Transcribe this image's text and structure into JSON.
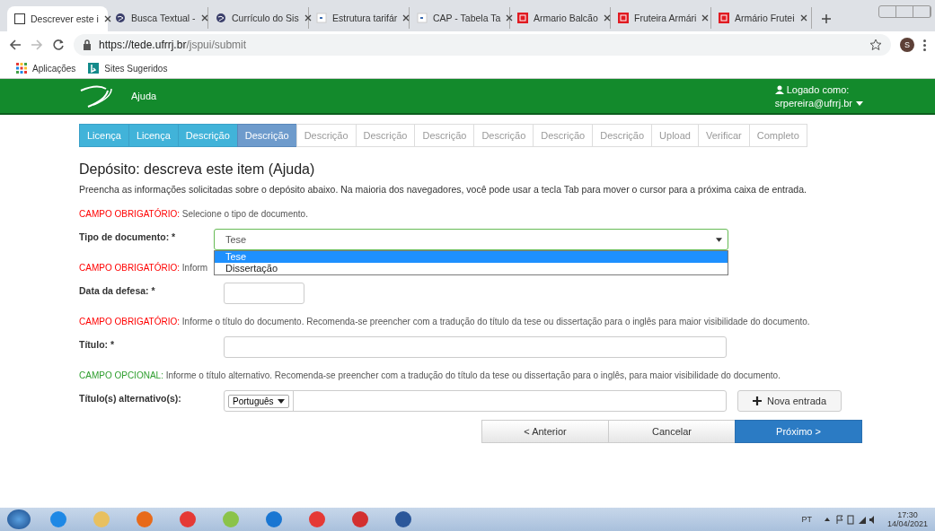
{
  "browser": {
    "tabs": [
      {
        "title": "Descrever este i",
        "kind": "d",
        "selected": true
      },
      {
        "title": "Busca Textual -",
        "kind": "globe",
        "selected": false
      },
      {
        "title": "Currículo do Sis",
        "kind": "globe",
        "selected": false
      },
      {
        "title": "Estrutura tarifár",
        "kind": "doc",
        "selected": false
      },
      {
        "title": "CAP - Tabela Ta",
        "kind": "doc",
        "selected": false
      },
      {
        "title": "Armario Balcão",
        "kind": "store",
        "selected": false
      },
      {
        "title": "Fruteira Armári",
        "kind": "store",
        "selected": false
      },
      {
        "title": "Armário Frutei",
        "kind": "store",
        "selected": false
      }
    ],
    "url_host": "https://tede.ufrrj.br",
    "url_path": "/jspui/submit",
    "profile_initial": "S",
    "bookmarks": [
      "Aplicações",
      "Sites Sugeridos"
    ]
  },
  "header": {
    "help": "Ajuda",
    "logged_label": "Logado como:",
    "user": "srpereira@ufrrj.br"
  },
  "steps": [
    {
      "label": "Licença",
      "kind": "done"
    },
    {
      "label": "Licença",
      "kind": "done"
    },
    {
      "label": "Descrição",
      "kind": "done"
    },
    {
      "label": "Descrição",
      "kind": "current"
    },
    {
      "label": "Descrição",
      "kind": "todo"
    },
    {
      "label": "Descrição",
      "kind": "todo"
    },
    {
      "label": "Descrição",
      "kind": "todo"
    },
    {
      "label": "Descrição",
      "kind": "todo"
    },
    {
      "label": "Descrição",
      "kind": "todo"
    },
    {
      "label": "Descrição",
      "kind": "todo"
    },
    {
      "label": "Upload",
      "kind": "todo"
    },
    {
      "label": "Verificar",
      "kind": "todo"
    },
    {
      "label": "Completo",
      "kind": "todo"
    }
  ],
  "title": "Depósito: descreva este item (Ajuda)",
  "intro": "Preencha as informações solicitadas sobre o depósito abaixo. Na maioria dos navegadores, você pode usar a tecla Tab para mover o cursor para a próxima caixa de entrada.",
  "fields": [
    {
      "kind": "select",
      "hint_tag": "CAMPO OBRIGATÓRIO:",
      "required": true,
      "hint": "Selecione o tipo de documento.",
      "label": "Tipo de documento: *",
      "value": "Tese",
      "options": [
        {
          "label": "Tese",
          "selected": true
        },
        {
          "label": "Dissertação",
          "selected": false
        }
      ]
    },
    {
      "kind": "date",
      "hint_tag": "CAMPO OBRIGATÓRIO:",
      "required": true,
      "hint": "Inform",
      "label": "Data da defesa: *"
    },
    {
      "kind": "text",
      "hint_tag": "CAMPO OBRIGATÓRIO:",
      "required": true,
      "hint": "Informe o título do documento. Recomenda-se preencher com a tradução do título da tese ou dissertação para o inglês para maior visibilidade do documento.",
      "label": "Título: *"
    },
    {
      "kind": "lang",
      "hint_tag": "CAMPO OPCIONAL:",
      "required": false,
      "hint": "Informe o título alternativo. Recomenda-se preencher com a tradução do título da tese ou dissertação para o inglês, para maior visibilidade do documento.",
      "label": "Título(s) alternativo(s):",
      "language": "Português",
      "add": "Nova entrada"
    }
  ],
  "buttons": [
    {
      "label": "< Anterior",
      "kind": "default"
    },
    {
      "label": "Cancelar",
      "kind": "default"
    },
    {
      "label": "Próximo >",
      "kind": "primary"
    }
  ],
  "tray": {
    "lang": "PT",
    "time": "17:30",
    "date": "14/04/2021"
  }
}
